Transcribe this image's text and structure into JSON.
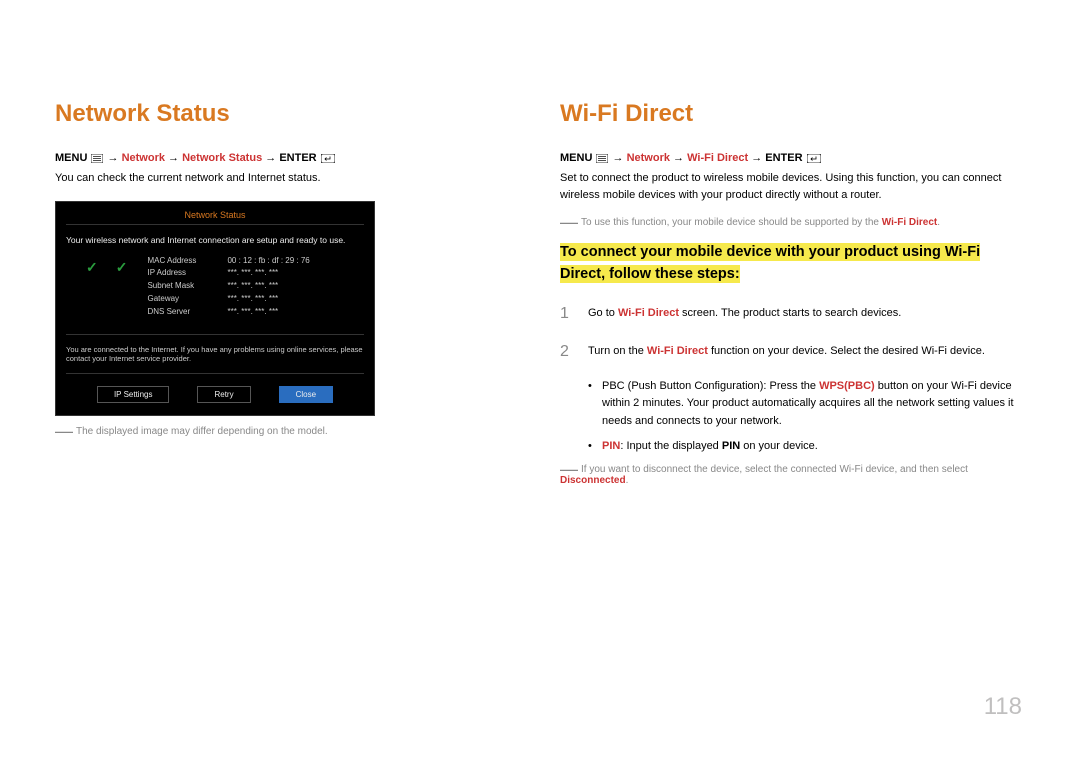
{
  "left": {
    "title": "Network Status",
    "path_pre": "MENU",
    "path_seg1": "Network",
    "path_seg2": "Network Status",
    "path_post": "ENTER",
    "desc": "You can check the current network and Internet status.",
    "scr": {
      "title": "Network Status",
      "msg": "Your wireless network and Internet connection are setup and ready to use.",
      "rows": [
        {
          "k": "MAC Address",
          "v": "00 : 12 : fb : df : 29 : 76"
        },
        {
          "k": "IP Address",
          "v": "***. ***. ***. ***"
        },
        {
          "k": "Subnet Mask",
          "v": "***. ***. ***. ***"
        },
        {
          "k": "Gateway",
          "v": "***. ***. ***. ***"
        },
        {
          "k": "DNS Server",
          "v": "***. ***. ***. ***"
        }
      ],
      "note": "You are connected to the Internet. If you have any problems using online services, please contact your Internet service provider.",
      "btn1": "IP Settings",
      "btn2": "Retry",
      "btn3": "Close"
    },
    "footnote": "The displayed image may differ depending on the model."
  },
  "right": {
    "title": "Wi-Fi Direct",
    "path_pre": "MENU",
    "path_seg1": "Network",
    "path_seg2": "Wi-Fi Direct",
    "path_post": "ENTER",
    "desc": "Set to connect the product to wireless mobile devices. Using this function, you can connect wireless mobile devices with your product directly without a router.",
    "note1_pre": "To use this function, your mobile device should be supported by the ",
    "note1_red": "Wi-Fi Direct",
    "highlight": "To connect your mobile device with your product using Wi-Fi Direct, follow these steps:",
    "step1_num": "1",
    "step1_a": "Go to ",
    "step1_b": "Wi-Fi Direct",
    "step1_c": " screen. The product starts to search devices.",
    "step2_num": "2",
    "step2_a": "Turn on the ",
    "step2_b": "Wi-Fi Direct",
    "step2_c": " function on your device. Select the desired Wi-Fi device.",
    "bul1_a": "PBC (Push Button Configuration): Press the ",
    "bul1_b": "WPS(PBC)",
    "bul1_c": " button on your Wi-Fi device within 2 minutes. Your product automatically acquires all the network setting values it needs and connects to your network.",
    "bul2_a": "PIN",
    "bul2_b": ": Input the displayed ",
    "bul2_c": "PIN",
    "bul2_d": " on your device.",
    "note2_a": "If you want to disconnect the device, select the connected Wi-Fi device, and then select ",
    "note2_b": "Disconnected"
  },
  "pagenum": "118"
}
